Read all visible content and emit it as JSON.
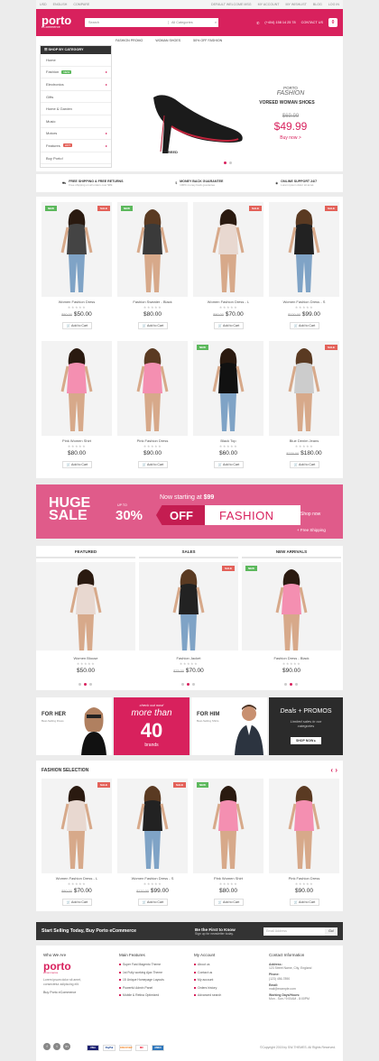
{
  "topbar": {
    "currency": "USD",
    "language": "ENGLISH",
    "compare": "COMPARE",
    "welcome": "DEFAULT WELCOME MSG",
    "links": [
      "MY ACCOUNT",
      "MY WISHLIST",
      "BLOG",
      "LOG IN"
    ]
  },
  "header": {
    "logo": "porto",
    "logo_sub": "eCommerce",
    "search_placeholder": "Search",
    "category_select": "All Categories",
    "phone": "(+404) 158 14 25 78",
    "contact": "CONTACT US",
    "cart_count": "0"
  },
  "nav": [
    "FASHION PROMO",
    "WOMAN SHOES",
    "50% OFF FASHION"
  ],
  "category_menu": {
    "title": "SHOP BY CATEGORY",
    "items": [
      {
        "label": "Home"
      },
      {
        "label": "Fashion",
        "badge": "NEW",
        "arrow": true
      },
      {
        "label": "Electronics",
        "arrow": true
      },
      {
        "label": "Gifts"
      },
      {
        "label": "Home & Garden"
      },
      {
        "label": "Music"
      },
      {
        "label": "Motors",
        "arrow": true
      },
      {
        "label": "Features",
        "badge": "HOT",
        "arrow": true
      },
      {
        "label": "Buy Porto!"
      }
    ]
  },
  "hero": {
    "brand": "PORTO",
    "line": "FASHION",
    "title": "VOREED WOMAN SHOES",
    "old_price": "$69.99",
    "price": "$49.99",
    "cta": "Buy now >",
    "shoe_brand": "VOREED"
  },
  "shipping": [
    {
      "title": "FREE SHIPPING & FREE RETURNS",
      "sub": "Free shipping on all orders over $99."
    },
    {
      "title": "MONEY BACK GUARANTEE",
      "sub": "100% money back guarantee"
    },
    {
      "title": "ONLINE SUPPORT 24/7",
      "sub": "Lorem ipsum dolor sit amet."
    }
  ],
  "add_to_cart": "Add to Cart",
  "stars": "★★★★★",
  "products_row1": [
    {
      "name": "Women Fashion Dress",
      "old": "$80.00",
      "price": "$50.00",
      "tag": "NEW",
      "tag2": "SALE"
    },
    {
      "name": "Fashion Sweater - Black",
      "old": "",
      "price": "$80.00",
      "tag": "NEW",
      "tag2": ""
    },
    {
      "name": "Women Fashion Dress - L",
      "old": "$80.00",
      "price": "$70.00",
      "tag": "",
      "tag2": "SALE"
    },
    {
      "name": "Women Fashion Dress - S",
      "old": "$120.00",
      "price": "$99.00",
      "tag": "",
      "tag2": "SALE"
    }
  ],
  "products_row2": [
    {
      "name": "Pink Women Shirt",
      "old": "",
      "price": "$80.00",
      "tag": "",
      "tag2": ""
    },
    {
      "name": "Pink Fashion Dress",
      "old": "",
      "price": "$90.00",
      "tag": "",
      "tag2": ""
    },
    {
      "name": "Black Top",
      "old": "",
      "price": "$60.00",
      "tag": "NEW",
      "tag2": ""
    },
    {
      "name": "Blue Denim Jeans",
      "old": "$220.00",
      "price": "$180.00",
      "tag": "",
      "tag2": "SALE"
    }
  ],
  "banner": {
    "huge": "HUGE",
    "sale": "SALE",
    "upto": "UP TO",
    "pct": "30%",
    "off": "OFF",
    "fashion": "FASHION",
    "starting": "Now starting at",
    "starting_price": "$99",
    "shop": "Shop now",
    "free": "+ Free Shipping"
  },
  "tabs": [
    {
      "title": "FEATURED",
      "name": "Women Blouse",
      "old": "",
      "price": "$50.00",
      "tag": ""
    },
    {
      "title": "SALES",
      "name": "Fashion Jacket",
      "old": "$75.00",
      "price": "$70.00",
      "tag": "SALE"
    },
    {
      "title": "NEW ARRIVALS",
      "name": "Fashion Dress - Black",
      "old": "",
      "price": "$90.00",
      "tag": "NEW"
    }
  ],
  "promos": {
    "forher": "FOR HER",
    "forher_sub": "Best-Selling Dress",
    "check": "check out now!",
    "more": "more than",
    "forty": "40",
    "brands": "brands",
    "forhim": "FOR HIM",
    "forhim_sub": "Best-Selling Shirts",
    "deals": "Deals",
    "promos": "+ PROMOS",
    "limited": "Limited sales in our categories",
    "shopnow": "SHOP NOW ▸"
  },
  "fashion_selection": {
    "title": "FASHION SELECTION",
    "items": [
      {
        "name": "Women Fashion Dress - L",
        "old": "$80.00",
        "price": "$70.00",
        "tag": "",
        "tag2": "SALE"
      },
      {
        "name": "Women Fashion Dress - S",
        "old": "$120.00",
        "price": "$99.00",
        "tag": "",
        "tag2": "SALE"
      },
      {
        "name": "Pink Women Shirt",
        "old": "",
        "price": "$80.00",
        "tag": "NEW",
        "tag2": ""
      },
      {
        "name": "Pink Fashion Dress",
        "old": "",
        "price": "$90.00",
        "tag": "",
        "tag2": ""
      }
    ]
  },
  "newsletter": {
    "left": "Start Selling Today, Buy Porto eCommerce",
    "title": "Be the First to Know",
    "sub": "Sign up for newsletter today.",
    "placeholder": "Email Address",
    "go": "Go!"
  },
  "footer": {
    "who": "Who We Are",
    "about": "Lorem ipsum dolor sit amet, consectetur adipiscing elit.",
    "buy": "Buy Porto eCommerce",
    "features_title": "Main Features",
    "features": [
      "Super Fast Magento Theme",
      "1st Fully working Ajax Theme",
      "15 Unique Homepage Layouts",
      "Powerful Admin Panel",
      "Mobile & Retina Optimized"
    ],
    "account_title": "My Account",
    "account": [
      "About us",
      "Contact us",
      "My account",
      "Orders history",
      "Advanced search"
    ],
    "contact_title": "Contact Information",
    "address_l": "Address:",
    "address": "123 Street Name, City, England",
    "phone_l": "Phone:",
    "phone": "(123) 456-7890",
    "email_l": "Email:",
    "email": "mail@example.com",
    "hours_l": "Working Days/Hours:",
    "hours": "Mon - Sun / 9:00AM - 8:00PM",
    "copyright": "©Copyright 2015 by SW-THEMES. All Rights Reserved.",
    "payments": [
      "VISA",
      "PayPal",
      "DISCOVER",
      "MC",
      "AMEX"
    ]
  },
  "colors": {
    "brand": "#d8215d",
    "banner": "#e05b8a",
    "sale": "#e36159",
    "new": "#5cb85c",
    "dark": "#333333"
  }
}
